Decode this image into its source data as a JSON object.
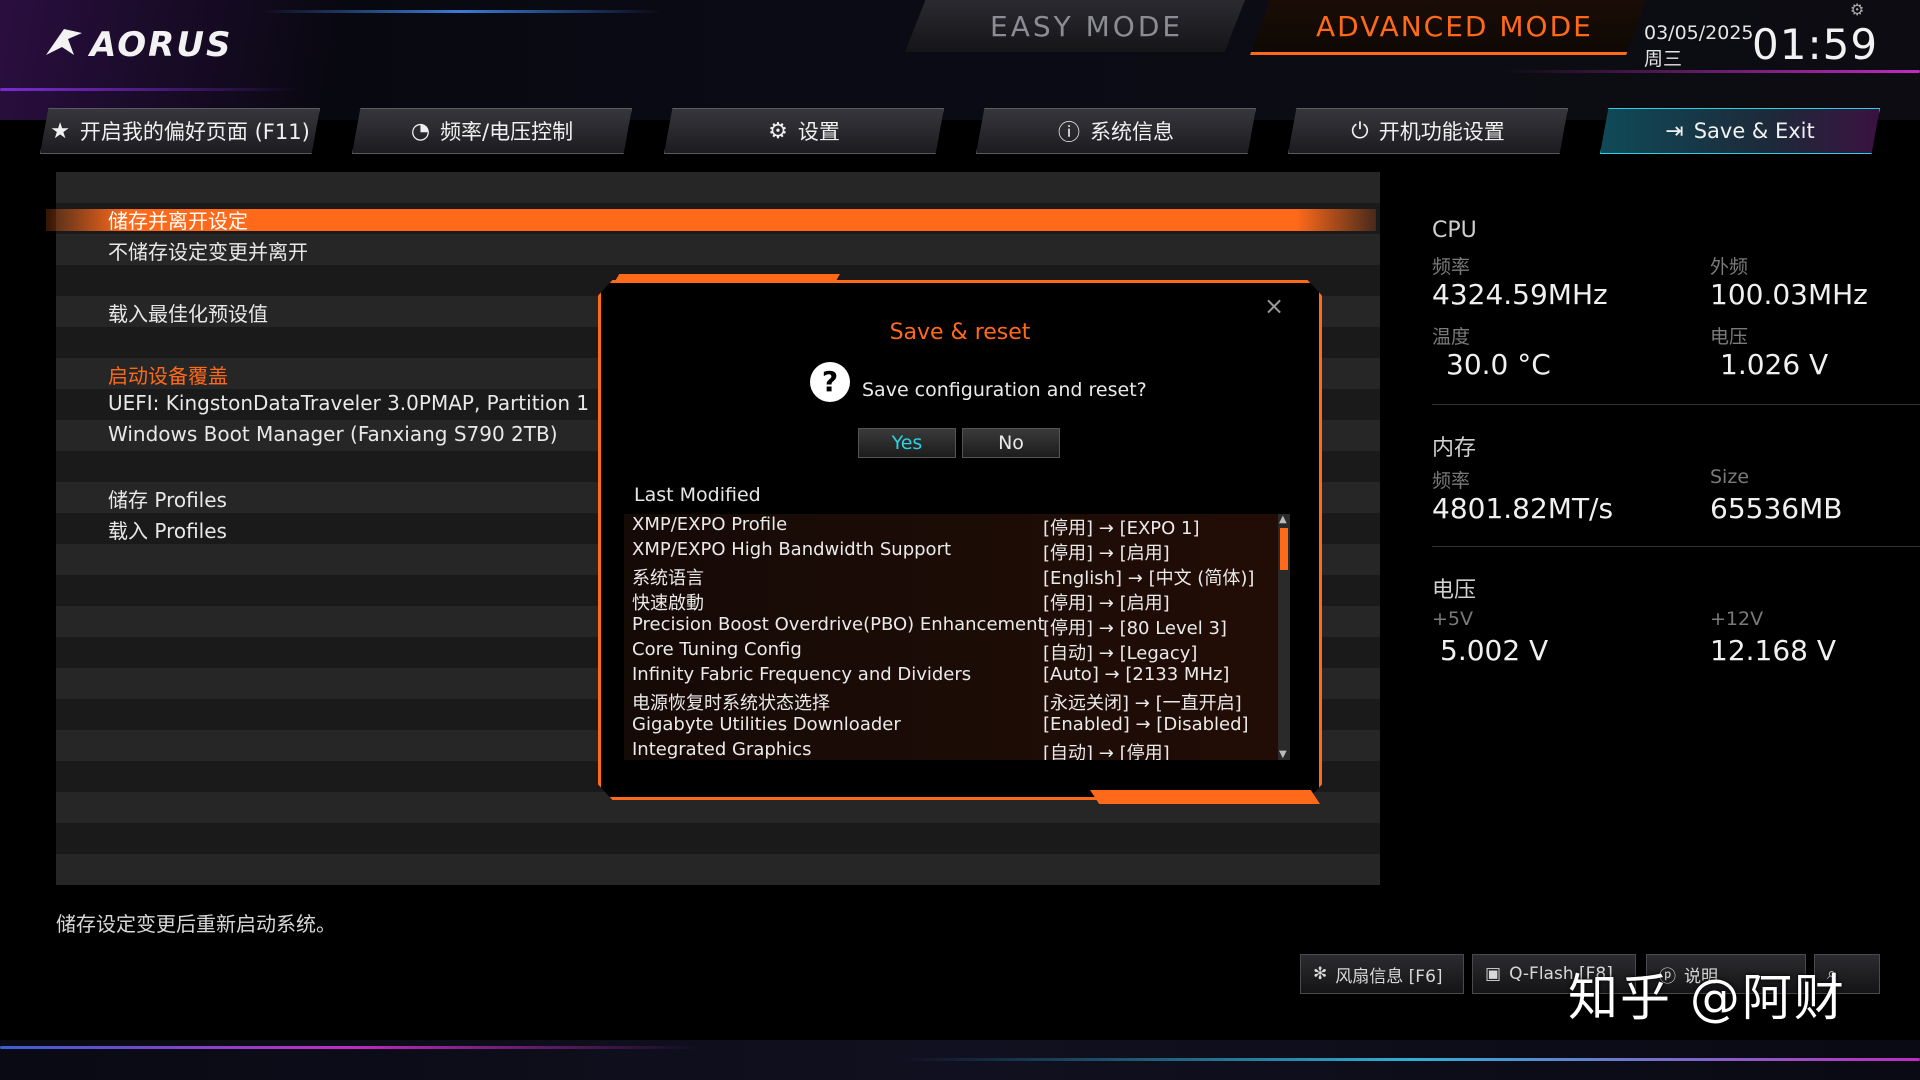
{
  "header": {
    "logo": "AORUS",
    "easy_mode": "EASY MODE",
    "advanced_mode": "ADVANCED MODE",
    "date": "03/05/2025",
    "weekday": "周三",
    "time": "01:59"
  },
  "nav": [
    {
      "label": "开启我的偏好页面 (F11)",
      "icon": "star-page-icon"
    },
    {
      "label": "频率/电压控制",
      "icon": "gauge-icon"
    },
    {
      "label": "设置",
      "icon": "gear-icon"
    },
    {
      "label": "系统信息",
      "icon": "info-icon"
    },
    {
      "label": "开机功能设置",
      "icon": "power-icon"
    },
    {
      "label": "Save & Exit",
      "icon": "exit-icon",
      "active": true
    }
  ],
  "menu": {
    "selected": "储存并离开设定",
    "items": [
      "不储存设定变更并离开",
      "载入最佳化预设值",
      "启动设备覆盖",
      "UEFI: KingstonDataTraveler 3.0PMAP, Partition 1",
      "Windows Boot Manager (Fanxiang S790 2TB)",
      "储存 Profiles",
      "载入 Profiles"
    ]
  },
  "help_text": "储存设定变更后重新启动系统。",
  "modal": {
    "title": "Save & reset",
    "question": "Save configuration and reset?",
    "yes": "Yes",
    "no": "No",
    "close": "×",
    "last_modified_label": "Last Modified",
    "changes": [
      {
        "name": "XMP/EXPO Profile",
        "change": "[停用] → [EXPO 1]"
      },
      {
        "name": "XMP/EXPO High Bandwidth Support",
        "change": "[停用] → [启用]"
      },
      {
        "name": "系统语言",
        "change": "[English] → [中文 (简体)]"
      },
      {
        "name": "快速啟動",
        "change": "[停用] → [启用]"
      },
      {
        "name": "Precision Boost Overdrive(PBO) Enhancement",
        "change": "[停用] → [80 Level 3]"
      },
      {
        "name": "Core Tuning Config",
        "change": "[自动] → [Legacy]"
      },
      {
        "name": "Infinity Fabric Frequency and Dividers",
        "change": "[Auto] → [2133 MHz]"
      },
      {
        "name": "电源恢复时系统状态选择",
        "change": "[永远关闭] → [一直开启]"
      },
      {
        "name": "Gigabyte Utilities Downloader",
        "change": "[Enabled] → [Disabled]"
      },
      {
        "name": "Integrated Graphics",
        "change": "[自动] → [停用]"
      }
    ]
  },
  "hw": {
    "cpu": {
      "title": "CPU",
      "freq_label": "频率",
      "freq": "4324.59MHz",
      "bclk_label": "外频",
      "bclk": "100.03MHz",
      "temp_label": "温度",
      "temp": "30.0 °C",
      "volt_label": "电压",
      "volt": "1.026 V"
    },
    "memory": {
      "title": "内存",
      "freq_label": "频率",
      "freq": "4801.82MT/s",
      "size_label": "Size",
      "size": "65536MB"
    },
    "voltage": {
      "title": "电压",
      "v5_label": "+5V",
      "v5": "5.002 V",
      "v12_label": "+12V",
      "v12": "12.168 V"
    }
  },
  "footer": {
    "fan": "风扇信息 [F6]",
    "qflash": "Q-Flash [F8]",
    "help": "说明"
  },
  "watermark": "知乎 @阿财",
  "colors": {
    "accent": "#ff6a1a",
    "active_nav": "#2fd0e0",
    "yes_text": "#2fd0e0"
  }
}
